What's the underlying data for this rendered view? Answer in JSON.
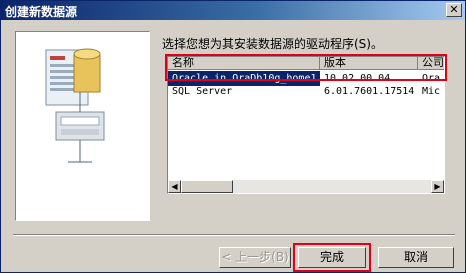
{
  "window": {
    "title": "创建新数据源",
    "close_label": "✕"
  },
  "prompt": "选择您想为其安装数据源的驱动程序(S)。",
  "list": {
    "columns": [
      "名称",
      "版本",
      "公司"
    ],
    "rows": [
      {
        "name": "Oracle in OraDb10g_home1",
        "version": "10.02.00.04",
        "company": "Ora",
        "selected": true
      },
      {
        "name": "SQL Server",
        "version": "6.01.7601.17514",
        "company": "Mic",
        "selected": false
      }
    ]
  },
  "buttons": {
    "back_label": "< 上一步(B)",
    "finish_label": "完成",
    "cancel_label": "取消"
  },
  "colors": {
    "highlight": "#e0001a",
    "selection": "#0a246a"
  }
}
